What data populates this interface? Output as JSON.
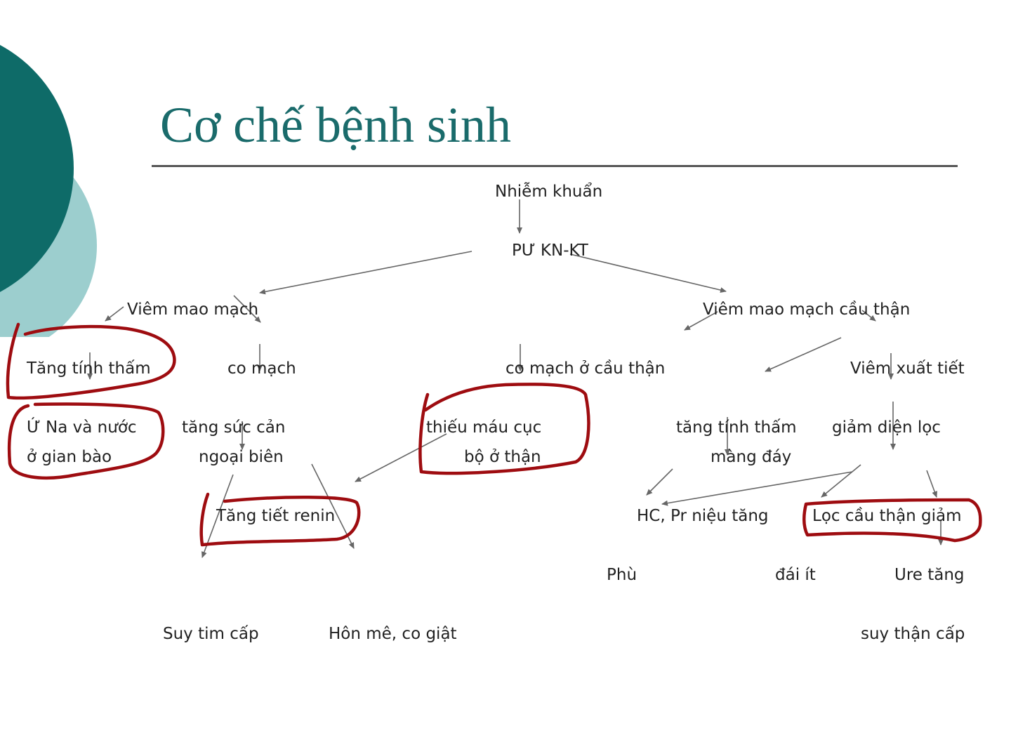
{
  "title": "Cơ chế bệnh sinh",
  "colors": {
    "title": "#1a6b6b",
    "circle_dark": "#0e6b68",
    "circle_light": "#9ccece",
    "arrow": "#666666",
    "annotation": "#9e0c10"
  },
  "nodes": {
    "infection": "Nhiễm khuẩn",
    "immune_reaction": "PƯ KN-KT",
    "capillaritis": "Viêm mao mạch",
    "glomerular_capillaritis": "Viêm mao mạch cầu thận",
    "increased_permeability": "Tăng tính thấm",
    "vasoconstriction": "co mạch",
    "glomerular_vasoconstriction": "co mạch ở cầu thận",
    "exudative_inflammation": "Viêm xuất tiết",
    "na_water_retention_line1": "Ứ Na và nước",
    "na_water_retention_line2": "ở gian bào",
    "increased_resistance_line1": "tăng sức cản",
    "increased_resistance_line2": "ngoại biên",
    "local_ischemia_line1": "thiếu máu cục",
    "local_ischemia_line2": "bộ ở thận",
    "membrane_permeability_line1": "tăng tính thấm",
    "membrane_permeability_line2": "màng đáy",
    "reduced_filtration_area": "giảm diện lọc",
    "increased_renin": "Tăng tiết renin",
    "hematuria_proteinuria": "HC, Pr niệu tăng",
    "reduced_gfr": "Lọc cầu thận giảm",
    "edema": "Phù",
    "oliguria": "đái ít",
    "urea_increase": "Ure tăng",
    "acute_heart_failure": "Suy tim cấp",
    "coma_seizure": "Hôn mê, co giật",
    "acute_renal_failure": "suy thận cấp"
  }
}
